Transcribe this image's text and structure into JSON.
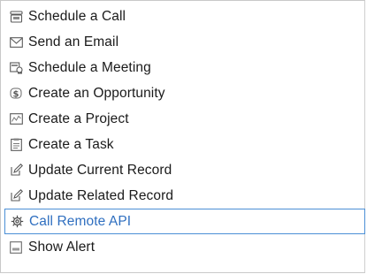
{
  "menu": {
    "accent_color": "#4b8fd6",
    "active_text_color": "#2f6fc0",
    "items": [
      {
        "label": "Schedule a Call",
        "icon": "phone-icon"
      },
      {
        "label": "Send an Email",
        "icon": "envelope-icon"
      },
      {
        "label": "Schedule a Meeting",
        "icon": "meeting-icon"
      },
      {
        "label": "Create an Opportunity",
        "icon": "dollar-icon"
      },
      {
        "label": "Create a Project",
        "icon": "project-icon"
      },
      {
        "label": "Create a Task",
        "icon": "task-icon"
      },
      {
        "label": "Update Current Record",
        "icon": "edit-icon"
      },
      {
        "label": "Update Related Record",
        "icon": "edit-related-icon"
      },
      {
        "label": "Call Remote API",
        "icon": "gear-icon",
        "active": true
      },
      {
        "label": "Show Alert",
        "icon": "alert-icon"
      }
    ]
  }
}
